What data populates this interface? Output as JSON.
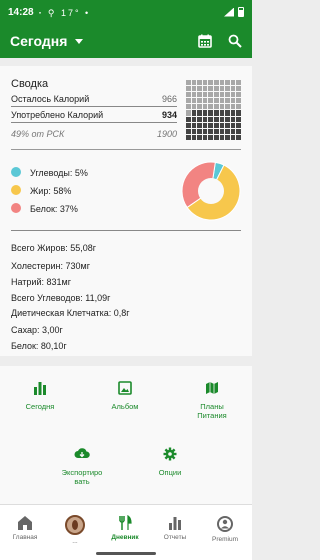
{
  "status_bar": {
    "time": "14:28",
    "left_icons": "ꞏ⿰ Q 17° •",
    "right_icons": [
      "signal-icon",
      "battery-icon"
    ]
  },
  "app_bar": {
    "title": "Сегодня",
    "actions": [
      "calendar-icon",
      "search-icon"
    ]
  },
  "summary": {
    "title": "Сводка",
    "rows": [
      {
        "label": "Осталось Калорий",
        "value": "966",
        "style": "muted"
      },
      {
        "label": "Употреблено Калорий",
        "value": "934",
        "style": "bold"
      },
      {
        "label": "49% от РСК",
        "value": "1900",
        "style": "italic"
      }
    ],
    "grid": {
      "cells": 100,
      "filled_fraction": 0.49
    }
  },
  "macros": {
    "items": [
      {
        "label": "Углеводы: 5%",
        "color": "#5bc8d6",
        "percent": 5
      },
      {
        "label": "Жир: 58%",
        "color": "#f7c74c",
        "percent": 58
      },
      {
        "label": "Белок: 37%",
        "color": "#f28482",
        "percent": 37
      }
    ]
  },
  "nutrients": [
    "Всего Жиров: 55,08г",
    "Холестерин: 730мг",
    "Натрий: 831мг",
    "Всего Углеводов: 11,09г",
    "Диетическая Клетчатка: 0,8г",
    "Сахар: 3,00г",
    "Белок: 80,10г"
  ],
  "actions": {
    "today": "Сегодня",
    "album": "Альбом",
    "plans": "Планы\nПитания",
    "export": "Экспортиро\nвать",
    "options": "Опции"
  },
  "bottom_nav": {
    "items": [
      {
        "label": "Главная",
        "icon": "home-icon"
      },
      {
        "label": "...",
        "icon": "avatar"
      },
      {
        "label": "Дневник",
        "icon": "utensils-icon",
        "active": true
      },
      {
        "label": "Отчеты",
        "icon": "bar-chart-icon"
      },
      {
        "label": "Premium",
        "icon": "premium-icon"
      }
    ]
  }
}
